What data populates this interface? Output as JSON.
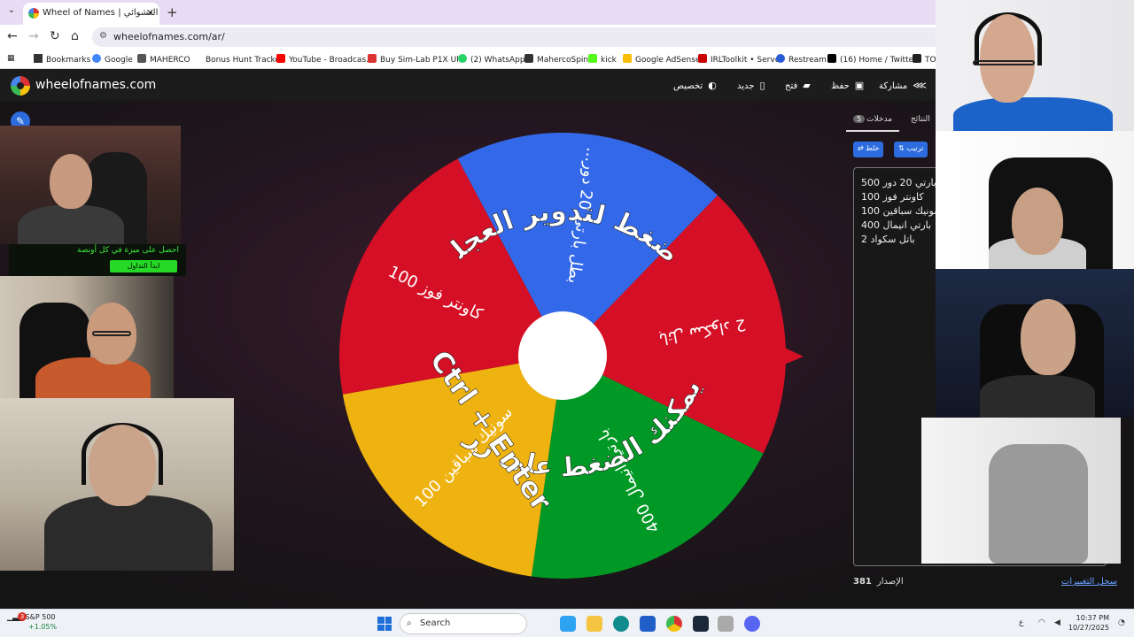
{
  "browser": {
    "tab_title": "Wheel of Names | اسم العشوائي",
    "url": "wheelofnames.com/ar/",
    "bookmarks": [
      "Bookmarks",
      "Google",
      "MAHERCO",
      "Bonus Hunt Tracker",
      "YouTube - Broadcas...",
      "Buy Sim-Lab P1X Ul...",
      "(2) WhatsApp",
      "MahercoSpin",
      "kick",
      "Google AdSense",
      "IRLToolkit • Server",
      "Restream",
      "(16) Home / Twitter",
      "TOD"
    ]
  },
  "app": {
    "site_name": "wheelofnames.com",
    "menu": {
      "share": "مشاركة",
      "save": "حفظ",
      "open": "فتح",
      "new": "جديد",
      "customize": "تخصيص"
    },
    "wheel": {
      "segments": [
        {
          "label": "...بطل بارتي 20 دور",
          "color": "#3369e8"
        },
        {
          "label": "باتل سكواد 2",
          "color": "#d50f25"
        },
        {
          "label": "بارتي انيمال 400",
          "color": "#009925"
        },
        {
          "label": "سونيك سباقين 100",
          "color": "#eeb211"
        },
        {
          "label": "كاونتر فوز 100",
          "color": "#d50f25"
        }
      ],
      "overlay_top": "اضغط لتدوير العجلة",
      "overlay_bottom": "أو يمكنك الضغط على زر",
      "overlay_shortcut": "Ctrl + Enter"
    },
    "panel": {
      "entries_tab": "مدخلات",
      "entries_count": "5",
      "results_tab": "النتائج",
      "shuffle_label": "خلط",
      "sort_label": "ترتيب",
      "entries": [
        "بطل بارتي 20 دور 500",
        "كاونتر فوز 100",
        "سونيك سباقين 100",
        "بارتي انيمال 400",
        "باتل سكواد 2"
      ],
      "version_label": "الإصدار",
      "version_number": "381",
      "changelog_label": "سجل التغييرات"
    }
  },
  "stream_overlay": {
    "ad_text": "احصل على ميزة في كل أونصة",
    "ad_button": "ابدأ التداول"
  },
  "taskbar": {
    "stock_name": "S&P 500",
    "stock_change": "+1.05%",
    "notification_count": "3",
    "search_placeholder": "Search",
    "time": "10:37 PM",
    "date": "10/27/2025",
    "lang": "ع"
  }
}
